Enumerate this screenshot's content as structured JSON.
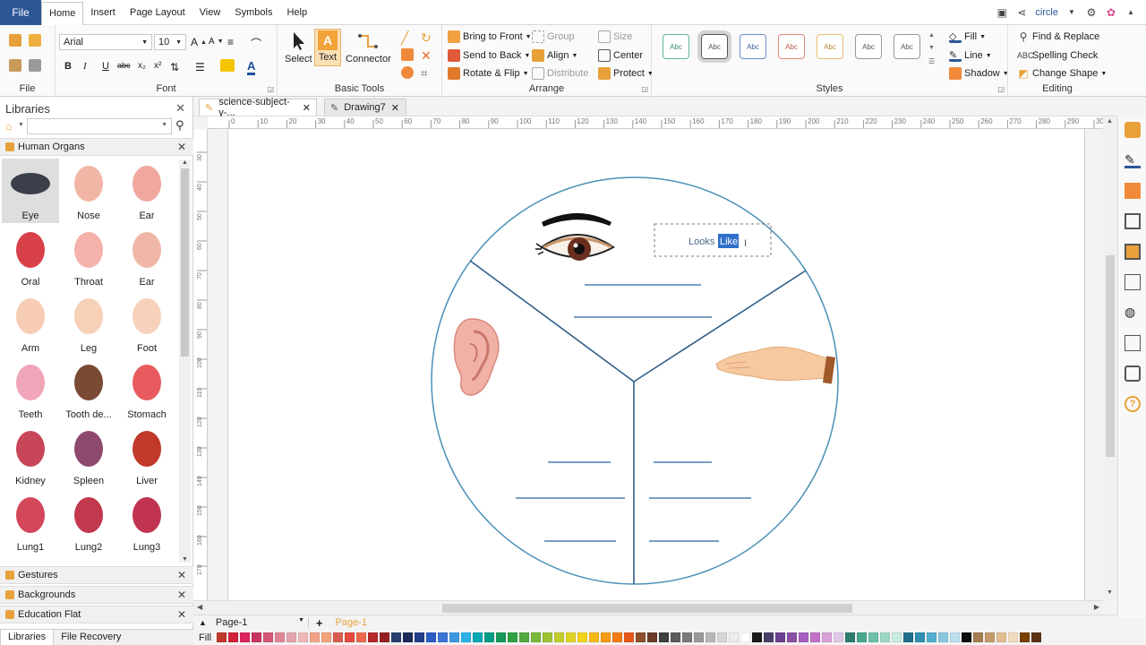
{
  "menubar": {
    "file": "File",
    "items": [
      "Home",
      "Insert",
      "Page Layout",
      "View",
      "Symbols",
      "Help"
    ],
    "active": "Home",
    "user": "circle"
  },
  "ribbon": {
    "file_group": {
      "label": "File"
    },
    "font_group": {
      "label": "Font",
      "font_name": "Arial",
      "font_size": "10"
    },
    "basic_tools": {
      "label": "Basic Tools",
      "select": "Select",
      "text": "Text",
      "connector": "Connector"
    },
    "arrange": {
      "label": "Arrange",
      "bring_to_front": "Bring to Front",
      "send_to_back": "Send to Back",
      "rotate_flip": "Rotate & Flip",
      "group": "Group",
      "align": "Align",
      "distribute": "Distribute",
      "size": "Size",
      "center": "Center",
      "protect": "Protect"
    },
    "styles": {
      "label": "Styles",
      "sample": "Abc",
      "count": 7
    },
    "format": {
      "fill": "Fill",
      "line": "Line",
      "shadow": "Shadow"
    },
    "editing": {
      "label": "Editing",
      "find_replace": "Find & Replace",
      "spelling": "Spelling Check",
      "change_shape": "Change Shape"
    }
  },
  "libraries": {
    "title": "Libraries",
    "category_open": "Human Organs",
    "shapes": [
      {
        "label": "Eye",
        "color": "#3a3f4a"
      },
      {
        "label": "Nose",
        "color": "#f2b6a6"
      },
      {
        "label": "Ear",
        "color": "#f0a7a0"
      },
      {
        "label": "Oral",
        "color": "#d9414a"
      },
      {
        "label": "Throat",
        "color": "#f4b2ab"
      },
      {
        "label": "Ear",
        "color": "#f0b7a8"
      },
      {
        "label": "Arm",
        "color": "#f6cdb4"
      },
      {
        "label": "Leg",
        "color": "#f7d0b8"
      },
      {
        "label": "Foot",
        "color": "#f7d1bb"
      },
      {
        "label": "Teeth",
        "color": "#f1a5b8"
      },
      {
        "label": "Tooth de...",
        "color": "#7b4a35"
      },
      {
        "label": "Stomach",
        "color": "#e85a5d"
      },
      {
        "label": "Kidney",
        "color": "#c7465a"
      },
      {
        "label": "Spleen",
        "color": "#8d4a6e"
      },
      {
        "label": "Liver",
        "color": "#c0392b"
      },
      {
        "label": "Lung1",
        "color": "#d2475a"
      },
      {
        "label": "Lung2",
        "color": "#c2384f"
      },
      {
        "label": "Lung3",
        "color": "#c03452"
      }
    ],
    "other_categories": [
      "Gestures",
      "Backgrounds",
      "Education Flat"
    ],
    "bottom_tabs": [
      "Libraries",
      "File Recovery"
    ]
  },
  "doctabs": [
    {
      "label": "science-subject-y-..."
    },
    {
      "label": "Drawing7"
    }
  ],
  "ruler": {
    "h_ticks": [
      "0",
      "10",
      "20",
      "30",
      "40",
      "50",
      "60",
      "70",
      "80",
      "90",
      "100",
      "110",
      "120",
      "130",
      "140",
      "150",
      "160",
      "170",
      "180",
      "190",
      "200",
      "210",
      "220",
      "230",
      "240",
      "250",
      "260",
      "270",
      "280",
      "290",
      "300"
    ],
    "v_ticks": [
      "30",
      "40",
      "50",
      "60",
      "70",
      "80",
      "90",
      "100",
      "110",
      "120",
      "130",
      "140",
      "150",
      "160",
      "170"
    ]
  },
  "canvas": {
    "textbox_text": "Looks ",
    "textbox_selected": "Like"
  },
  "pagebar": {
    "page_select": "Page-1",
    "active_tab": "Page-1"
  },
  "palette": {
    "label": "Fill",
    "colors": [
      "#c0392b",
      "#d3213a",
      "#e0245e",
      "#c8375f",
      "#d65877",
      "#e08596",
      "#e3a3ad",
      "#f0b9b9",
      "#f2a387",
      "#f5a37a",
      "#d95d4f",
      "#e34a3d",
      "#ec6a4c",
      "#b72828",
      "#962020",
      "#2a3f6e",
      "#1d2b5a",
      "#223d8a",
      "#2d5cc4",
      "#3b76d6",
      "#3b98e0",
      "#2ab1e8",
      "#00a7b3",
      "#009c85",
      "#15985a",
      "#2fa245",
      "#53a93f",
      "#78b83b",
      "#9cc435",
      "#c0cc2c",
      "#e0d324",
      "#f3d31b",
      "#f7b817",
      "#f59b14",
      "#f27b13",
      "#e8581a",
      "#8f4f2c",
      "#6a3d28",
      "#3f3f3f",
      "#5c5c5c",
      "#7a7a7a",
      "#999999",
      "#b7b7b7",
      "#d5d5d5",
      "#ececec",
      "#ffffff",
      "#1b1b1b",
      "#4a3f6b",
      "#6b3f8f",
      "#8b4fa6",
      "#a560c0",
      "#c070c8",
      "#d8a0d8",
      "#e0c8e8",
      "#2e7d6f",
      "#4aa58f",
      "#6cc1a8",
      "#9cd8c4",
      "#c8ecdf",
      "#1f6f8b",
      "#2f8fb0",
      "#55aed0",
      "#89c7e0",
      "#bde0ef",
      "#0d0d0d",
      "#a67c52",
      "#c49a6c",
      "#e0bc90",
      "#f2dcbf",
      "#7b3f00",
      "#5a3413"
    ]
  }
}
